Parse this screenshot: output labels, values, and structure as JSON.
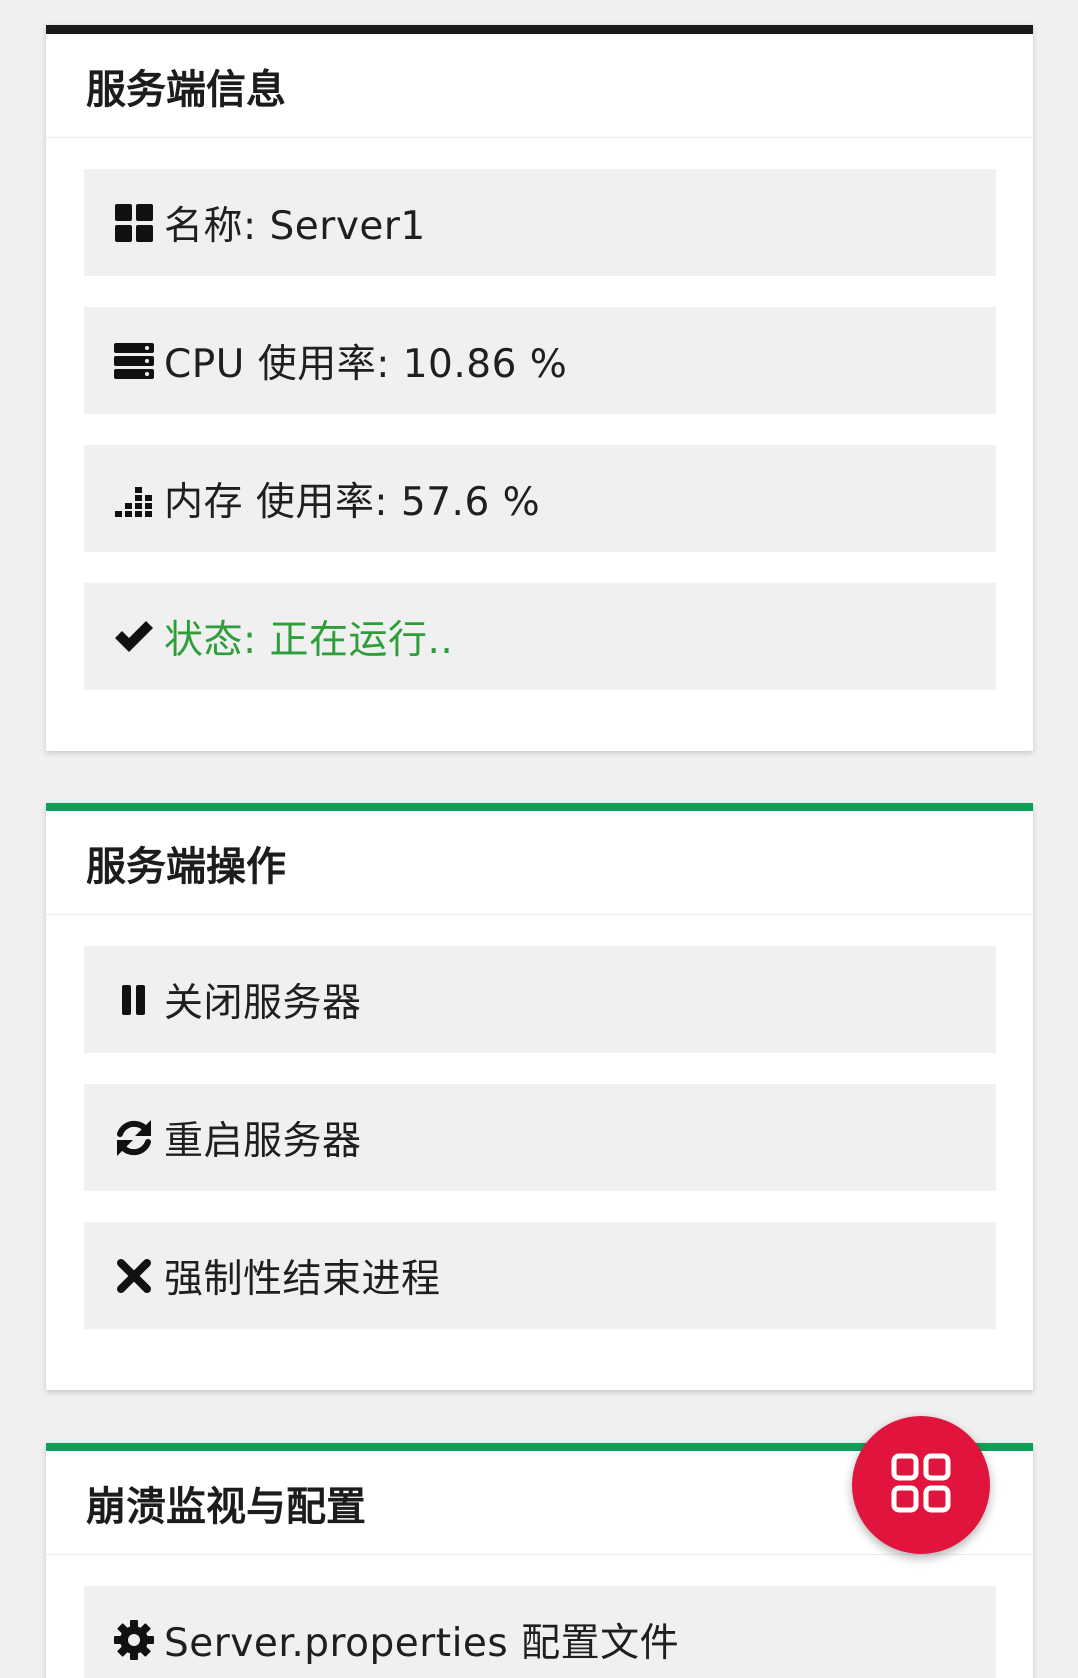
{
  "info_card": {
    "title": "服务端信息",
    "items": [
      {
        "icon": "grid-icon",
        "text": "名称: Server1"
      },
      {
        "icon": "server-icon",
        "text": "CPU 使用率: 10.86 %"
      },
      {
        "icon": "bar-chart-icon",
        "text": "内存 使用率: 57.6 %"
      },
      {
        "icon": "check-icon",
        "text": "状态: 正在运行..",
        "color": "#2d9e3a"
      }
    ]
  },
  "ops_card": {
    "title": "服务端操作",
    "items": [
      {
        "icon": "pause-icon",
        "text": "关闭服务器"
      },
      {
        "icon": "refresh-icon",
        "text": "重启服务器"
      },
      {
        "icon": "close-icon",
        "text": "强制性结束进程"
      }
    ]
  },
  "config_card": {
    "title": "崩溃监视与配置",
    "items": [
      {
        "icon": "gear-icon",
        "text": "Server.properties 配置文件"
      }
    ]
  },
  "fab": {
    "icon": "apps-grid-icon"
  },
  "colors": {
    "background": "#f0f0f0",
    "accent_dark": "#1a1a1a",
    "accent_green": "#0ea05a",
    "status_green": "#2d9e3a",
    "fab_red": "#e0143c"
  }
}
